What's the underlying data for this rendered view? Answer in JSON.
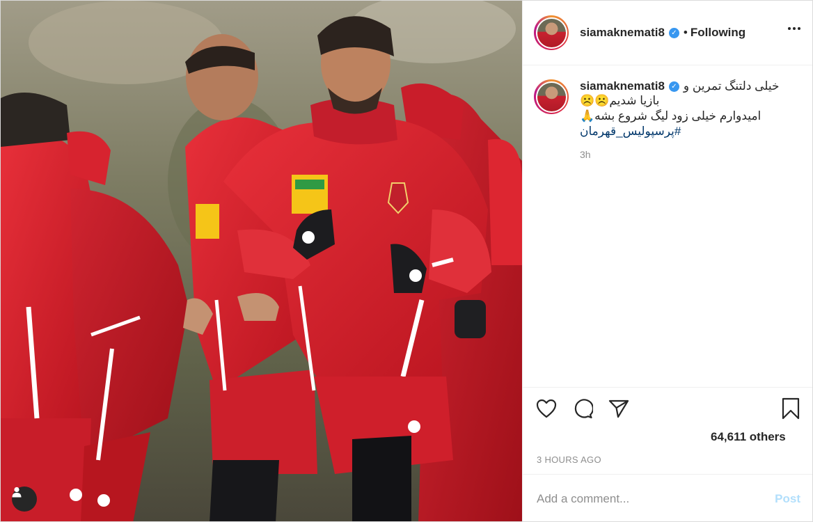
{
  "post": {
    "username": "siamaknemati8",
    "follow_status": "Following",
    "separator": "•",
    "verified_mark": "✓"
  },
  "caption": {
    "line1": "خیلی دلتنگ تمرین و",
    "line2": "بازیا شدیم☹️☹️",
    "line3": "امیدوارم خیلی زود لیگ شروع بشه🙏",
    "hashtag": "#پرسپولیس_قهرمان",
    "time": "3h"
  },
  "actions": {
    "likes_text": "64,611 others",
    "date_text": "3 HOURS AGO"
  },
  "comment": {
    "placeholder": "Add a comment...",
    "post_label": "Post"
  },
  "icons": {
    "like": "heart-icon",
    "comment": "comment-bubble-icon",
    "share": "paper-plane-icon",
    "save": "bookmark-icon",
    "more": "ellipsis-icon",
    "tags": "user-tag-icon"
  },
  "colors": {
    "link": "#00376b",
    "muted": "#8e8e8e",
    "verified": "#3897f0",
    "post_disabled": "#b2dffc",
    "kit_red": "#d8202c"
  }
}
